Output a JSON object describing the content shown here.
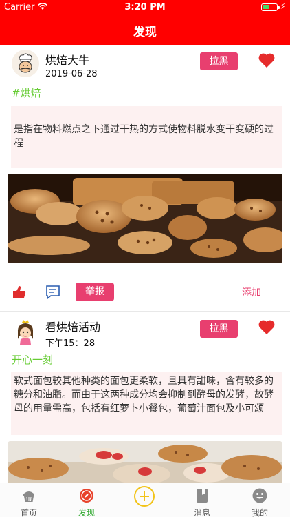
{
  "status": {
    "carrier": "Carrier",
    "time": "3:20 PM"
  },
  "nav": {
    "title": "发现"
  },
  "posts": [
    {
      "username": "烘焙大牛",
      "date": "2019-06-28",
      "block_label": "拉黑",
      "tag": "#烘焙",
      "text": "是指在物料燃点之下通过干热的方式使物料脱水变干变硬的过程",
      "report_label": "举报",
      "add_label": "添加"
    },
    {
      "username": "看烘焙活动",
      "date": "下午15：28",
      "block_label": "拉黑",
      "tag": "开心一刻",
      "text": "软式面包较其他种类的面包更柔软，且具有甜味，含有较多的糖分和油脂。而由于这两种成分均会抑制到酵母的发酵，故酵母的用量需高，包括有红萝卜小餐包，葡萄汁面包及小可颂"
    }
  ],
  "tabbar": {
    "items": [
      {
        "label": "首页",
        "icon": "cake-icon"
      },
      {
        "label": "发现",
        "icon": "compass-icon"
      },
      {
        "label": "",
        "icon": "plus-circle-icon"
      },
      {
        "label": "消息",
        "icon": "bookmark-icon"
      },
      {
        "label": "我的",
        "icon": "smiley-icon"
      }
    ],
    "active": "发现"
  },
  "colors": {
    "nav_background": "#ff0000",
    "accent_pink": "#e83f6f",
    "heart_red": "#e62b2b",
    "tag_green": "#66cc33",
    "active_tab_green": "#33aa33",
    "post_text_background": "#fdf1f1",
    "plus_yellow": "#f2c318"
  }
}
